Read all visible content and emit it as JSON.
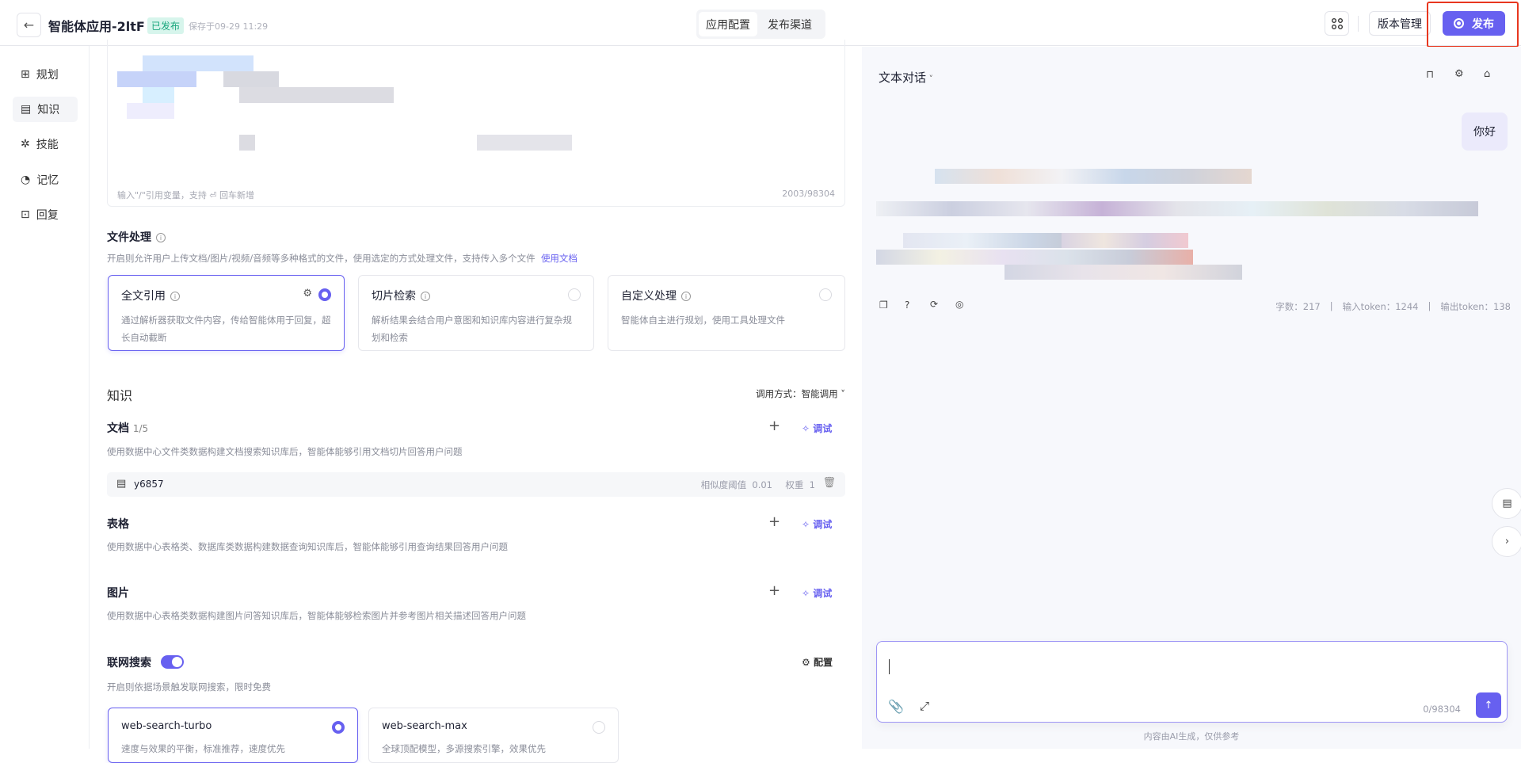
{
  "header": {
    "title": "智能体应用-2ltF",
    "status": "已发布",
    "saved": "保存于09-29 11:29",
    "tabs": [
      "应用配置",
      "发布渠道"
    ],
    "version_label": "版本管理",
    "publish_label": "发布"
  },
  "sidebar": {
    "items": [
      "规划",
      "知识",
      "技能",
      "记忆",
      "回复"
    ],
    "active": 1
  },
  "prompt": {
    "hint_prefix": "输入\"/\"引用变量，支持",
    "hint_suffix": "回车新增",
    "count": "2003/98304"
  },
  "file": {
    "title": "文件处理",
    "desc": "开启则允许用户上传文档/图片/视频/音频等多种格式的文件，使用选定的方式处理文件，支持传入多个文件",
    "doc_link": "使用文档",
    "options": [
      {
        "title": "全文引用",
        "desc": "通过解析器获取文件内容，传给智能体用于回复，超长自动截断",
        "selected": true
      },
      {
        "title": "切片检索",
        "desc": "解析结果会结合用户意图和知识库内容进行复杂规划和检索",
        "selected": false
      },
      {
        "title": "自定义处理",
        "desc": "智能体自主进行规划，使用工具处理文件",
        "selected": false
      }
    ]
  },
  "knowledge": {
    "title": "知识",
    "mode_label": "调用方式：",
    "mode_value": "智能调用",
    "add": "+",
    "debug": "调试",
    "doc": {
      "title": "文档",
      "count": "1/5",
      "desc": "使用数据中心文件类数据构建文档搜索知识库后，智能体能够引用文档切片回答用户问题",
      "item": {
        "name": "y6857",
        "threshold_label": "相似度阈值",
        "threshold": "0.01",
        "weight_label": "权重",
        "weight": "1"
      }
    },
    "table": {
      "title": "表格",
      "desc": "使用数据中心表格类、数据库类数据构建数据查询知识库后，智能体能够引用查询结果回答用户问题"
    },
    "image": {
      "title": "图片",
      "desc": "使用数据中心表格类数据构建图片问答知识库后，智能体能够检索图片并参考图片相关描述回答用户问题"
    }
  },
  "web": {
    "title": "联网搜索",
    "enabled": true,
    "config": "配置",
    "desc": "开启则依据场景触发联网搜索，限时免费",
    "options": [
      {
        "title": "web-search-turbo",
        "desc": "速度与效果的平衡，标准推荐，速度优先",
        "selected": true
      },
      {
        "title": "web-search-max",
        "desc": "全球顶配模型，多源搜索引擎，效果优先",
        "selected": false
      }
    ]
  },
  "chat": {
    "mode": "文本对话",
    "user_msg": "你好",
    "stats": {
      "chars": "字数：217",
      "input": "输入token：1244",
      "output": "输出token：138"
    },
    "input_count": "0/98304",
    "disclaimer": "内容由AI生成，仅供参考"
  },
  "colors": {
    "accent": "#6760f0",
    "published": "#1aa77d",
    "highlight": "#e8371f"
  }
}
